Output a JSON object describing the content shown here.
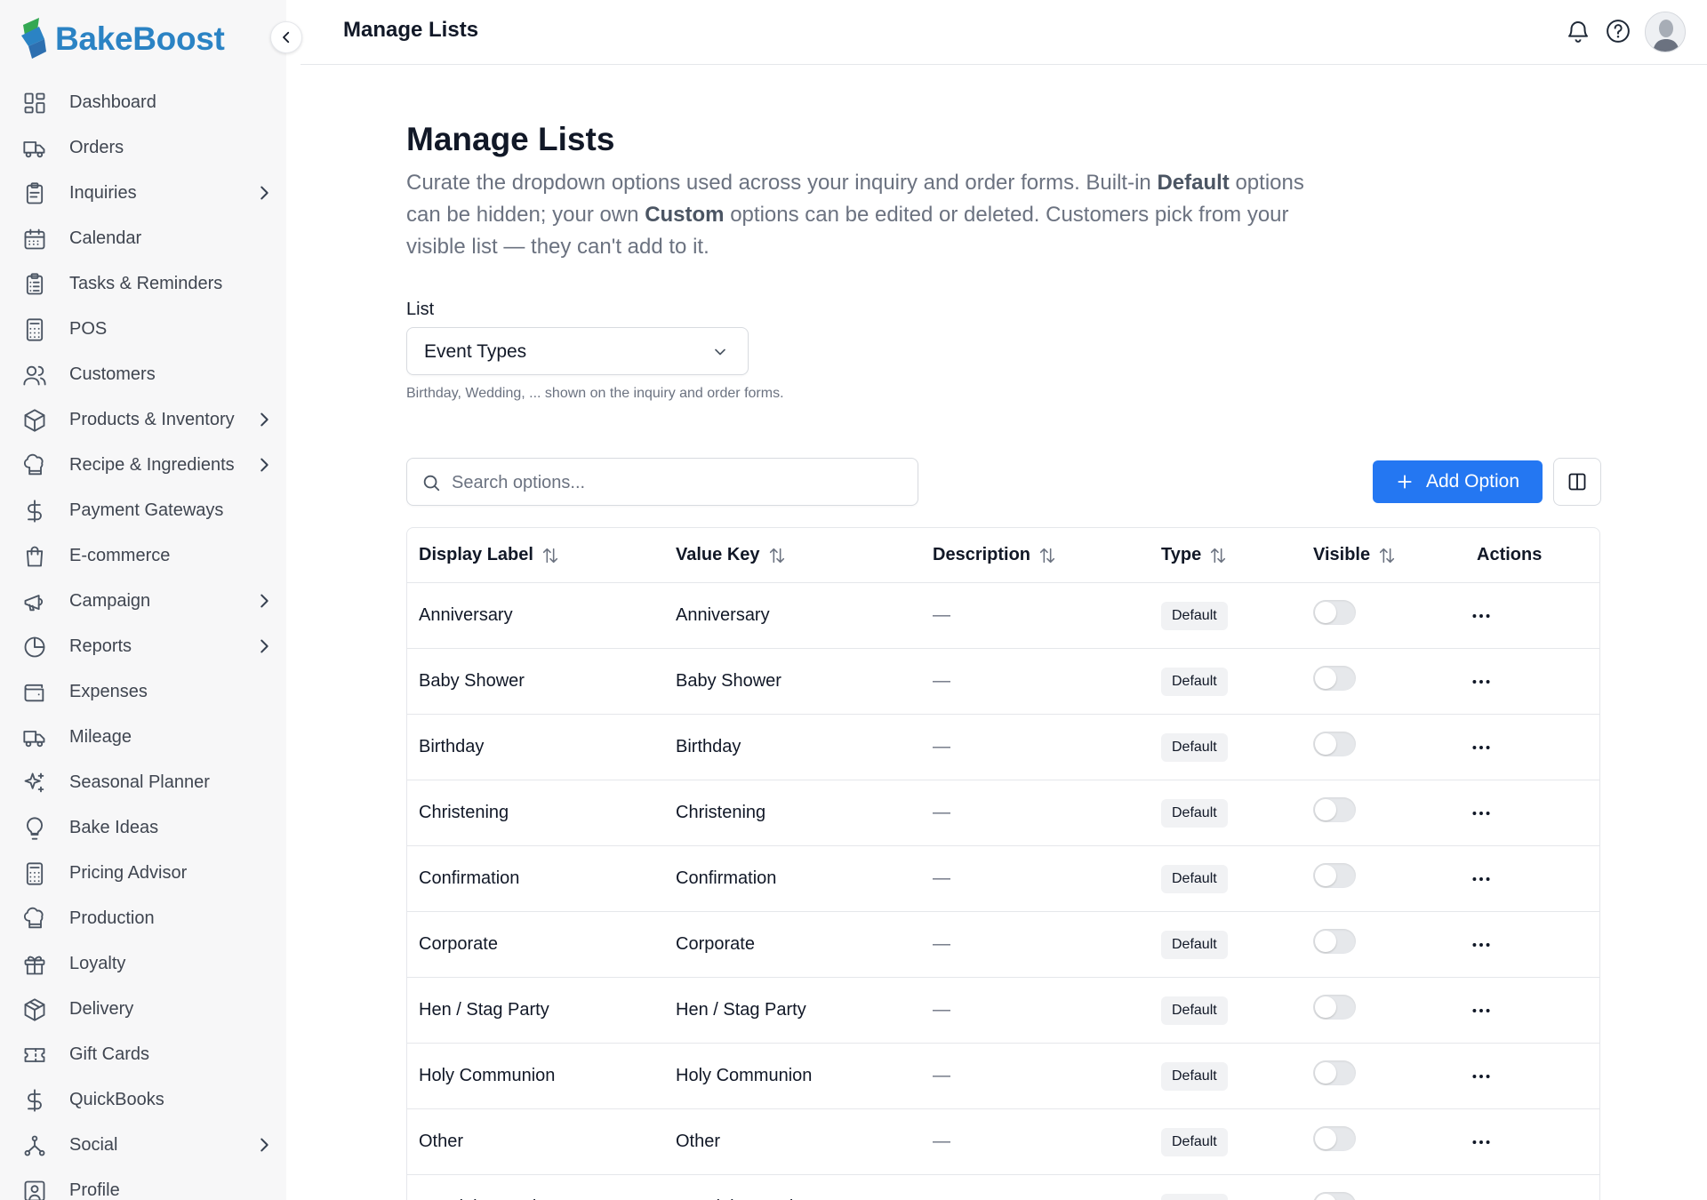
{
  "brand": {
    "name": "BakeBoost",
    "logo_colors": [
      "#34a853",
      "#2b83c4"
    ]
  },
  "sidebar": {
    "items": [
      {
        "label": "Dashboard",
        "icon": "dashboard-icon",
        "chevron": false
      },
      {
        "label": "Orders",
        "icon": "truck-icon",
        "chevron": false
      },
      {
        "label": "Inquiries",
        "icon": "clipboard-icon",
        "chevron": true
      },
      {
        "label": "Calendar",
        "icon": "calendar-icon",
        "chevron": false
      },
      {
        "label": "Tasks & Reminders",
        "icon": "clipboard-list-icon",
        "chevron": false
      },
      {
        "label": "POS",
        "icon": "calculator-icon",
        "chevron": false
      },
      {
        "label": "Customers",
        "icon": "users-icon",
        "chevron": false
      },
      {
        "label": "Products & Inventory",
        "icon": "box-icon",
        "chevron": true
      },
      {
        "label": "Recipe & Ingredients",
        "icon": "chef-hat-icon",
        "chevron": true
      },
      {
        "label": "Payment Gateways",
        "icon": "dollar-icon",
        "chevron": false
      },
      {
        "label": "E-commerce",
        "icon": "shopping-bag-icon",
        "chevron": false
      },
      {
        "label": "Campaign",
        "icon": "megaphone-icon",
        "chevron": true
      },
      {
        "label": "Reports",
        "icon": "pie-chart-icon",
        "chevron": true
      },
      {
        "label": "Expenses",
        "icon": "wallet-icon",
        "chevron": false
      },
      {
        "label": "Mileage",
        "icon": "truck-icon",
        "chevron": false
      },
      {
        "label": "Seasonal Planner",
        "icon": "sparkles-icon",
        "chevron": false
      },
      {
        "label": "Bake Ideas",
        "icon": "lightbulb-icon",
        "chevron": false
      },
      {
        "label": "Pricing Advisor",
        "icon": "calculator-icon",
        "chevron": false
      },
      {
        "label": "Production",
        "icon": "chef-hat-icon",
        "chevron": false
      },
      {
        "label": "Loyalty",
        "icon": "gift-icon",
        "chevron": false
      },
      {
        "label": "Delivery",
        "icon": "package-icon",
        "chevron": false
      },
      {
        "label": "Gift Cards",
        "icon": "ticket-icon",
        "chevron": false
      },
      {
        "label": "QuickBooks",
        "icon": "dollar-icon",
        "chevron": false
      },
      {
        "label": "Social",
        "icon": "network-icon",
        "chevron": true
      },
      {
        "label": "Profile",
        "icon": "profile-icon",
        "chevron": false
      }
    ]
  },
  "header": {
    "title": "Manage Lists"
  },
  "page": {
    "title": "Manage Lists",
    "desc_1": "Curate the dropdown options used across your inquiry and order forms. Built-in ",
    "desc_default": "Default",
    "desc_2": " options can be hidden; your own ",
    "desc_custom": "Custom",
    "desc_3": " options can be edited or deleted. Customers pick from your visible list — they can't add to it.",
    "list_label": "List",
    "list_value": "Event Types",
    "list_hint": "Birthday, Wedding, ... shown on the inquiry and order forms.",
    "search_placeholder": "Search options...",
    "add_button": "Add Option"
  },
  "table": {
    "columns": [
      "Display Label",
      "Value Key",
      "Description",
      "Type",
      "Visible",
      "Actions"
    ],
    "rows": [
      {
        "label": "Anniversary",
        "key": "Anniversary",
        "desc": "—",
        "type": "Default",
        "visible": false
      },
      {
        "label": "Baby Shower",
        "key": "Baby Shower",
        "desc": "—",
        "type": "Default",
        "visible": false
      },
      {
        "label": "Birthday",
        "key": "Birthday",
        "desc": "—",
        "type": "Default",
        "visible": false
      },
      {
        "label": "Christening",
        "key": "Christening",
        "desc": "—",
        "type": "Default",
        "visible": false
      },
      {
        "label": "Confirmation",
        "key": "Confirmation",
        "desc": "—",
        "type": "Default",
        "visible": false
      },
      {
        "label": "Corporate",
        "key": "Corporate",
        "desc": "—",
        "type": "Default",
        "visible": false
      },
      {
        "label": "Hen / Stag Party",
        "key": "Hen / Stag Party",
        "desc": "—",
        "type": "Default",
        "visible": false
      },
      {
        "label": "Holy Communion",
        "key": "Holy Communion",
        "desc": "—",
        "type": "Default",
        "visible": false
      },
      {
        "label": "Other",
        "key": "Other",
        "desc": "—",
        "type": "Default",
        "visible": false
      },
      {
        "label": "Special Occasion",
        "key": "Special Occasion",
        "desc": "—",
        "type": "Default",
        "visible": false
      }
    ]
  },
  "colors": {
    "accent": "#2477f2",
    "brand": "#2b83c4",
    "sidebar_bg": "#f7f7f8"
  }
}
